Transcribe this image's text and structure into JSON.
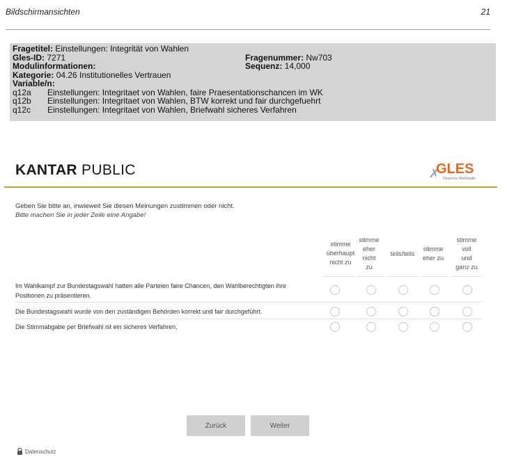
{
  "page_header": {
    "title": "Bildschirmansichten",
    "page_number": "21"
  },
  "meta": {
    "fragetitel_label": "Fragetitel:",
    "fragetitel": "Einstellungen: Integrität von Wahlen",
    "gles_id_label": "Gles-ID:",
    "gles_id": "7271",
    "fragenummer_label": "Fragenummer:",
    "fragenummer": "Nw703",
    "modul_label": "Modulinformationen:",
    "sequenz_label": "Sequenz:",
    "sequenz": "14,000",
    "kategorie_label": "Kategorie:",
    "kategorie": "04.26 Institutionelles Vertrauen",
    "variable_label": "Variable/n:",
    "variables": [
      {
        "code": "q12a",
        "text": "Einstellungen: Integritaet von Wahlen, faire Praesentationschancen im WK"
      },
      {
        "code": "q12b",
        "text": "Einstellungen: Integritaet von Wahlen, BTW korrekt und fair durchgefuehrt"
      },
      {
        "code": "q12c",
        "text": "Einstellungen: Integritaet von Wahlen, Briefwahl sicheres Verfahren"
      }
    ]
  },
  "survey": {
    "logo_left_bold": "KANTAR",
    "logo_left_rest": " PUBLIC",
    "logo_right": "GLES",
    "logo_right_sub": "Deutsche Wahlstudie",
    "question": "Geben Sie bitte an, inwieweit Sie diesen Meinungen zustimmen oder nicht.",
    "hint": "Bitte machen Sie in jeder Zeile eine Angabe!",
    "scale": [
      [
        "stimme",
        "überhaupt",
        "nicht zu"
      ],
      [
        "stimme",
        "eher",
        "nicht",
        "zu"
      ],
      [
        "teils/teils"
      ],
      [
        "stimme",
        "eher zu"
      ],
      [
        "stimme",
        "voll",
        "und",
        "ganz zu"
      ]
    ],
    "items": [
      {
        "line1": "Im Wahlkampf zur Bundestagswahl hatten alle Parteien faire Chancen, den Wahlberechtigten ihre",
        "line2": "Positionen zu präsentieren."
      },
      {
        "line1": "Die Bundestagswahl wurde von den zuständigen Behörden korrekt und fair durchgeführt.",
        "line2": ""
      },
      {
        "line1": "Die Stimmabgabe per Briefwahl ist ein sicheres Verfahren.",
        "line2": ""
      }
    ],
    "back_button": "Zurück",
    "next_button": "Weiter",
    "privacy": "Datenschutz"
  }
}
